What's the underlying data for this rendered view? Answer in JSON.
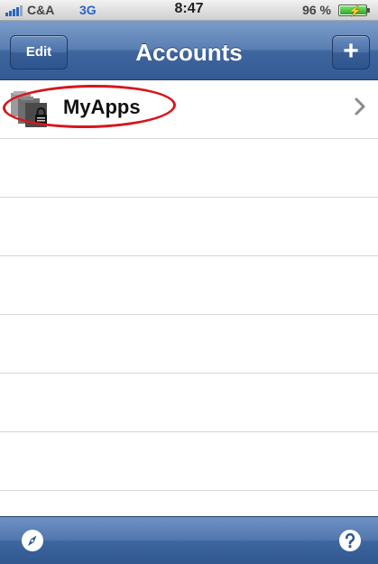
{
  "status_bar": {
    "carrier": "C&A",
    "network": "3G",
    "time": "8:47",
    "battery_percent": "96 %",
    "battery_level": 0.96,
    "signal_icon": "signal-bars-icon",
    "battery_icon": "battery-charging-icon"
  },
  "nav_bar": {
    "title": "Accounts",
    "edit_label": "Edit",
    "add_label": "+",
    "add_icon": "plus-icon"
  },
  "accounts": {
    "items": [
      {
        "label": "MyApps",
        "icon": "locked-folders-icon",
        "accessory": "chevron-right-icon"
      }
    ],
    "highlight": {
      "color": "#d7161c",
      "shape": "ellipse"
    }
  },
  "toolbar": {
    "left_icon": "compass-icon",
    "right_icon": "help-question-icon"
  },
  "colors": {
    "nav_blue": "#4c71a8",
    "separator": "#d6d6d6",
    "annotation_red": "#d7161c"
  }
}
